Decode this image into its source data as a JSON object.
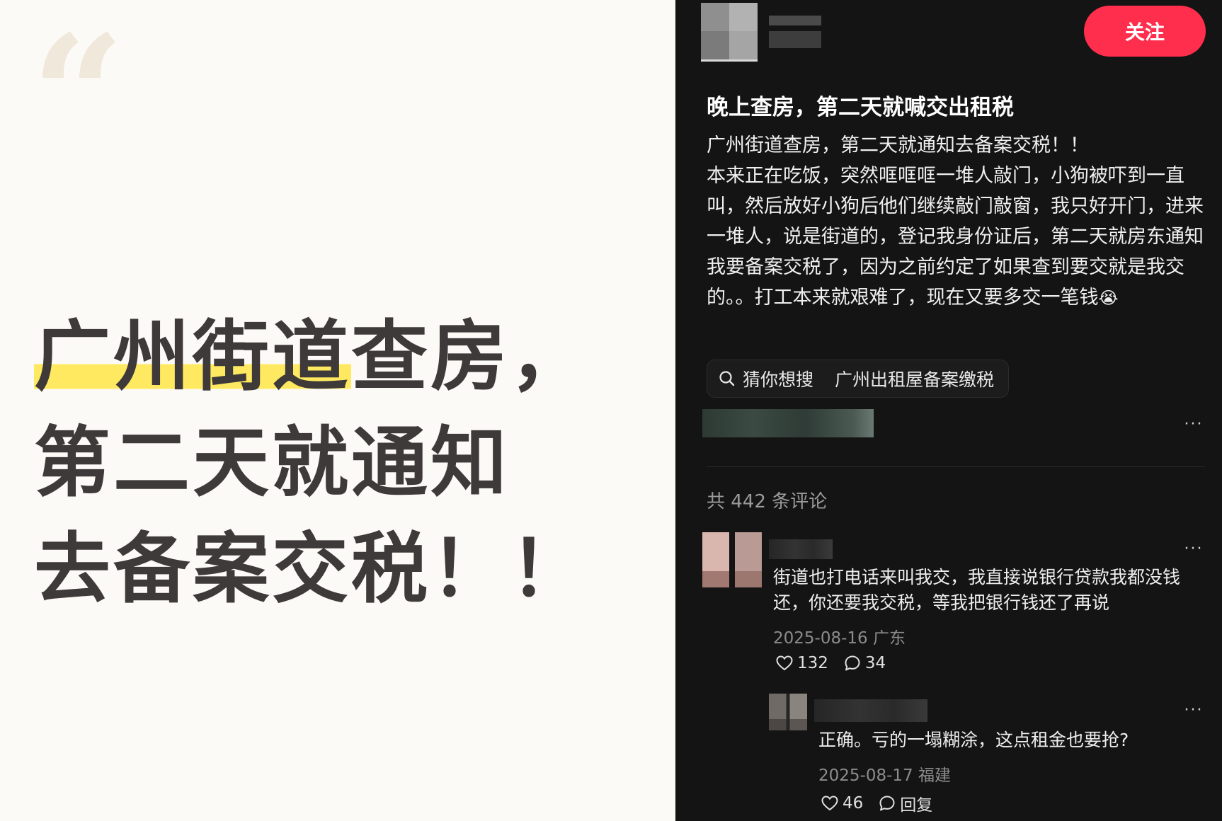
{
  "cover": {
    "quote_mark": "“",
    "headline_line1_highlight": "广州街道",
    "headline_line1_rest": "查房，",
    "headline_line2": "第二天就通知",
    "headline_line3": "去备案交税！！"
  },
  "header": {
    "follow_label": "关注"
  },
  "post": {
    "title": "晚上查房，第二天就喊交出租税",
    "body_line1": "广州街道查房，第二天就通知去备案交税！！",
    "body_para2": "本来正在吃饭，突然哐哐哐一堆人敲门，小狗被吓到一直叫，然后放好小狗后他们继续敲门敲窗，我只好开门，进来一堆人，说是街道的，登记我身份证后，第二天就房东通知我要备案交税了，因为之前约定了如果查到要交就是我交的。。打工本来就艰难了，现在又要多交一笔钱",
    "body_emoji": "😭",
    "search_prefix": "猜你想搜",
    "search_query": "广州出租屋备案缴税",
    "more_label": "···"
  },
  "comments_section": {
    "count_label": "共 442 条评论",
    "comments": [
      {
        "text": "街道也打电话来叫我交，我直接说银行贷款我都没钱还，你还要我交税，等我把银行钱还了再说",
        "meta": "2025-08-16 广东",
        "likes": "132",
        "replies": "34",
        "more": "···"
      }
    ],
    "reply": {
      "text": "正确。亏的一塌糊涂，这点租金也要抢?",
      "meta": "2025-08-17 福建",
      "likes": "46",
      "reply_label": "回复",
      "more": "···"
    }
  },
  "colors": {
    "follow_button": "#ff2e4d",
    "panel_bg": "#141414",
    "cover_bg": "#fcfaf6",
    "highlight": "#ffe960"
  },
  "icons": [
    "search-icon",
    "heart-icon",
    "comment-icon",
    "more-icon"
  ]
}
